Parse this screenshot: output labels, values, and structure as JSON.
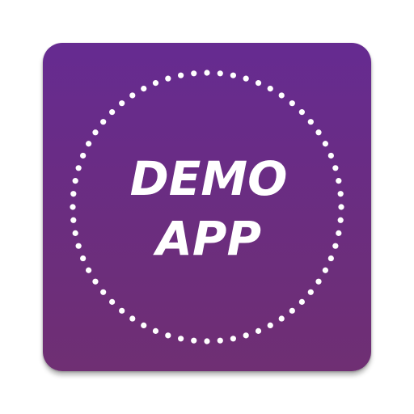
{
  "icon": {
    "line1": "DEMO",
    "line2": "APP",
    "colors": {
      "background_top": "#662b91",
      "background_bottom": "#6f2f73",
      "foreground": "#ffffff"
    },
    "decoration": "dotted-circle-ring"
  }
}
